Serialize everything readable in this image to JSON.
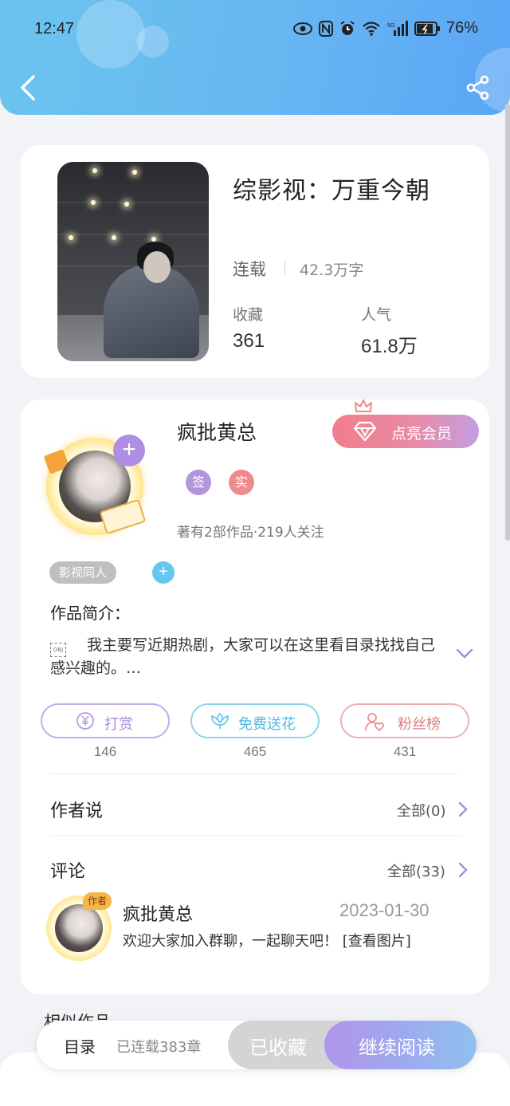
{
  "status_bar": {
    "time": "12:47",
    "battery": "76%"
  },
  "book": {
    "title": "综影视：万重今朝",
    "status": "连载",
    "word_count": "42.3万字",
    "favorites_label": "收藏",
    "favorites_value": "361",
    "popularity_label": "人气",
    "popularity_value": "61.8万"
  },
  "author": {
    "name": "疯批黄总",
    "follow_symbol": "+",
    "vip_label": "点亮会员",
    "badges": [
      "签",
      "实"
    ],
    "meta": "著有2部作品·219人关注",
    "tag": "影视同人",
    "tag_add_symbol": "+"
  },
  "intro": {
    "label": "作品简介：",
    "image_placeholder": "OBJ",
    "text": "我主要写近期热剧，大家可以在这里看目录找找自己感兴趣的。…"
  },
  "actions": [
    {
      "label": "打赏",
      "count": "146",
      "color": "#b49be6"
    },
    {
      "label": "免费送花",
      "count": "465",
      "color": "#6dc6e8"
    },
    {
      "label": "粉丝榜",
      "count": "431",
      "color": "#e98e94"
    }
  ],
  "author_says": {
    "title": "作者说",
    "link": "全部(0)"
  },
  "comments": {
    "title": "评论",
    "link": "全部(33)",
    "items": [
      {
        "author_tag": "作者",
        "name": "疯批黄总",
        "date": "2023-01-30",
        "text": "欢迎大家加入群聊，一起聊天吧！ [查看图片]"
      }
    ]
  },
  "similar_title": "相似作品",
  "bottom_bar": {
    "toc": "目录",
    "chapters": "已连载383章",
    "collected": "已收藏",
    "continue": "继续阅读"
  },
  "colors": {
    "header": "#67b6f2",
    "accent_purple": "#b08ee6",
    "vip_pink": "#f27d8b"
  }
}
